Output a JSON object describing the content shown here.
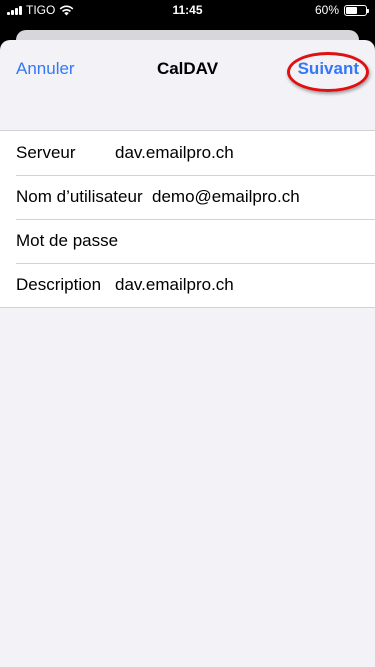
{
  "status_bar": {
    "carrier": "TIGO",
    "time": "11:45",
    "battery_percent": "60%",
    "battery_level": 0.6
  },
  "nav": {
    "cancel_label": "Annuler",
    "title": "CalDAV",
    "next_label": "Suivant"
  },
  "form": {
    "rows": [
      {
        "label": "Serveur",
        "value": "dav.emailpro.ch"
      },
      {
        "label": "Nom d’utilisateur",
        "value": "demo@emailpro.ch"
      },
      {
        "label": "Mot de passe",
        "value": ""
      },
      {
        "label": "Description",
        "value": "dav.emailpro.ch"
      }
    ]
  },
  "colors": {
    "accent": "#3478f6",
    "highlight": "#e01010",
    "background": "#f2f2f7"
  },
  "icons": [
    "signal-icon",
    "wifi-icon",
    "battery-icon"
  ]
}
